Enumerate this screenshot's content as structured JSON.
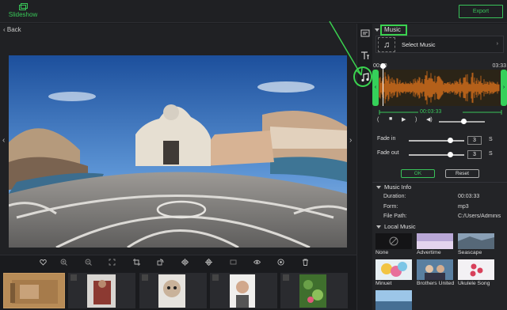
{
  "topbar": {
    "slideshow_label": "Slideshow",
    "export_label": "Export"
  },
  "preview": {
    "back_label": "Back"
  },
  "music": {
    "header": "Music",
    "select_label": "Select Music",
    "start_time": "00:00",
    "end_time": "03:33",
    "length": "00:03:33",
    "fade_in_label": "Fade in",
    "fade_in_value": "3",
    "fade_out_label": "Fade out",
    "fade_out_value": "3",
    "unit": "S",
    "ok_label": "OK",
    "reset_label": "Reset",
    "volume_level": 0.55,
    "fade_in_level": 0.75,
    "fade_out_level": 0.75
  },
  "music_info": {
    "header": "Music Info",
    "duration_label": "Duration:",
    "duration_value": "00:03:33",
    "form_label": "Form:",
    "form_value": "mp3",
    "path_label": "File Path:",
    "path_value": "C:/Users/Adminis"
  },
  "local_music": {
    "header": "Local Music",
    "items": [
      {
        "label": "None"
      },
      {
        "label": "Advertime"
      },
      {
        "label": "Seascape"
      },
      {
        "label": "Minuet"
      },
      {
        "label": "Brothers United"
      },
      {
        "label": "Ukulele Song"
      },
      {
        "label": ""
      }
    ]
  },
  "colors": {
    "accent": "#39c35a",
    "waveform": "#d9701c"
  }
}
